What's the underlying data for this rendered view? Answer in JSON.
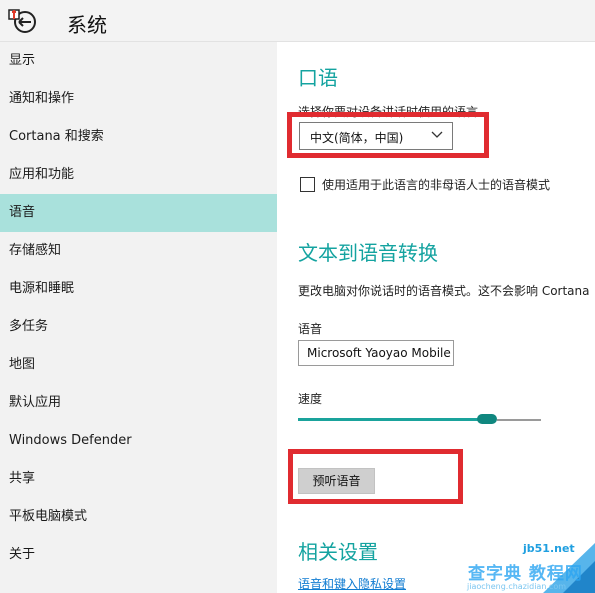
{
  "window": {
    "title": "系统"
  },
  "sidebar": {
    "items": [
      {
        "label": "显示"
      },
      {
        "label": "通知和操作"
      },
      {
        "label": "Cortana 和搜索"
      },
      {
        "label": "应用和功能"
      },
      {
        "label": "语音",
        "selected": true
      },
      {
        "label": "存储感知"
      },
      {
        "label": "电源和睡眠"
      },
      {
        "label": "多任务"
      },
      {
        "label": "地图"
      },
      {
        "label": "默认应用"
      },
      {
        "label": "Windows Defender"
      },
      {
        "label": "共享"
      },
      {
        "label": "平板电脑模式"
      },
      {
        "label": "关于"
      }
    ]
  },
  "speech": {
    "heading": "口语",
    "language_label": "选择你要对设备讲话时使用的语言",
    "language_value": "中文(简体，中国)",
    "nonnative_checkbox_label": "使用适用于此语言的非母语人士的语音模式",
    "nonnative_checked": false
  },
  "tts": {
    "heading": "文本到语音转换",
    "description": "更改电脑对你说话时的语音模式。这不会影响 Cortana",
    "voice_label": "语音",
    "voice_value": "Microsoft Yaoyao Mobile",
    "speed_label": "速度",
    "speed_level": 0.82,
    "preview_button": "预听语音"
  },
  "related": {
    "heading": "相关设置",
    "link": "语音和键入隐私设置"
  },
  "watermark": {
    "site": "jb51.net",
    "text": "查字典 教程网",
    "url": "jiaocheng.chazidian.com"
  },
  "colors": {
    "accent": "#14a3a0",
    "selected_nav": "#a9e1dc",
    "highlight_box": "#e02b30",
    "link": "#0f7bd1"
  }
}
